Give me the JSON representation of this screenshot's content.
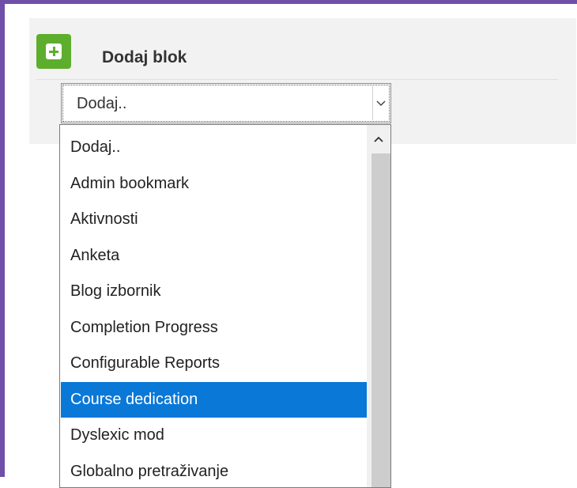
{
  "block": {
    "title": "Dodaj blok"
  },
  "select": {
    "value": "Dodaj.."
  },
  "dropdown": {
    "options": [
      "Dodaj..",
      "Admin bookmark",
      "Aktivnosti",
      "Anketa",
      "Blog izbornik",
      "Completion Progress",
      "Configurable Reports",
      "Course dedication",
      "Dyslexic mod",
      "Globalno pretraživanje"
    ],
    "selected": "Course dedication"
  },
  "colors": {
    "frame_accent": "#6f4fa8",
    "add_icon": "#5eae2d",
    "selection": "#0a78d7"
  }
}
